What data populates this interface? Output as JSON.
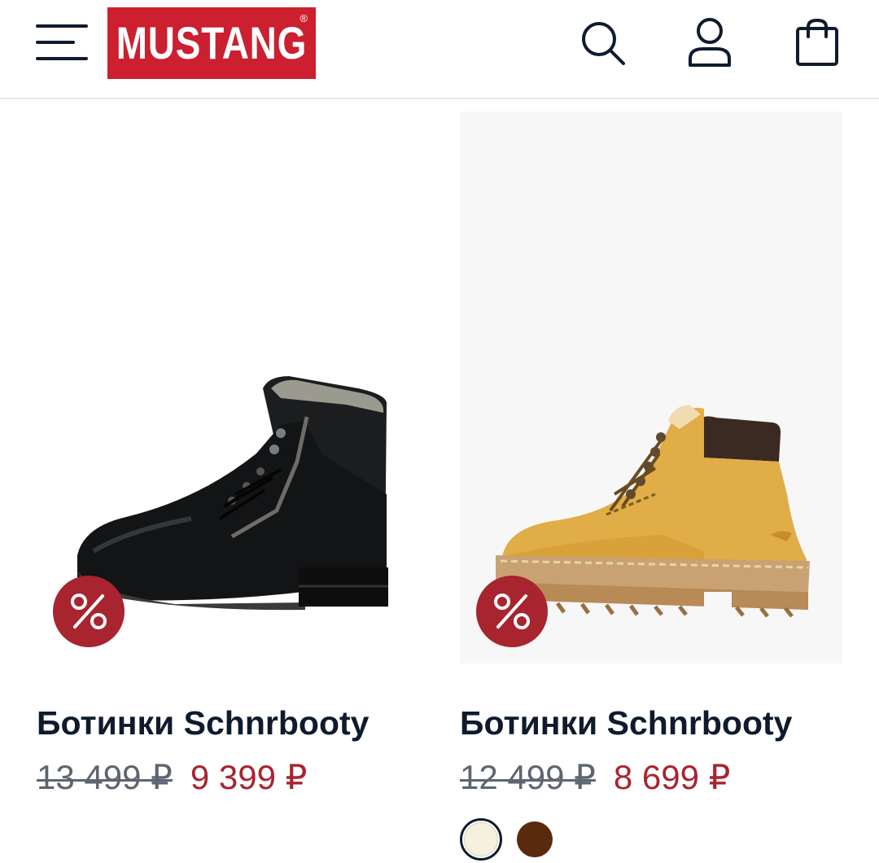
{
  "header": {
    "logo_text": "MUSTANG",
    "logo_mark": "®",
    "logo_color": "#cc1f2f",
    "icons": [
      "menu-icon",
      "search-icon",
      "user-icon",
      "shopping-bag-icon"
    ]
  },
  "products": [
    {
      "title": "Ботинки Schnrbooty",
      "old_price": "13 499 ₽",
      "new_price": "9 399 ₽",
      "badge": "%",
      "image": "black-leather-zip-boot",
      "swatches": []
    },
    {
      "title": "Ботинки Schnrbooty",
      "old_price": "12 499 ₽",
      "new_price": "8 699 ₽",
      "badge": "%",
      "image": "yellow-nubuck-lace-boot",
      "swatches": [
        {
          "color": "#f6f1dc",
          "selected": true
        },
        {
          "color": "#5a2a0e",
          "selected": false
        }
      ]
    }
  ],
  "colors": {
    "discount": "#a8242f",
    "text": "#0f1b2d",
    "old_price": "#5d6670"
  }
}
